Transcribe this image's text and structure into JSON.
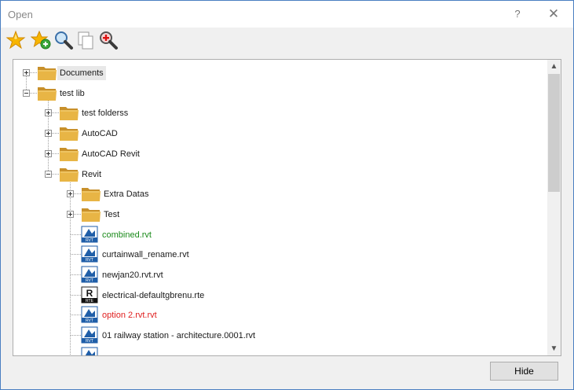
{
  "window": {
    "title": "Open",
    "help": "?",
    "close": "✕"
  },
  "toolbar": [
    {
      "icon": "star-icon",
      "name": "favorites-button"
    },
    {
      "icon": "add-favorite-icon",
      "name": "add-favorite-button"
    },
    {
      "icon": "search-icon",
      "name": "search-button"
    },
    {
      "icon": "copy-pages-icon",
      "name": "copy-button"
    },
    {
      "icon": "zoom-in-icon",
      "name": "zoom-button"
    }
  ],
  "tree": {
    "items": [
      {
        "label": "Documents",
        "kind": "folder",
        "level": 0,
        "expander": "plus",
        "selected": true
      },
      {
        "label": "test lib",
        "kind": "folder",
        "level": 0,
        "expander": "minus"
      },
      {
        "label": "test folderss",
        "kind": "folder",
        "level": 1,
        "expander": "plus"
      },
      {
        "label": "AutoCAD",
        "kind": "folder",
        "level": 1,
        "expander": "plus"
      },
      {
        "label": "AutoCAD Revit",
        "kind": "folder",
        "level": 1,
        "expander": "plus"
      },
      {
        "label": "Revit",
        "kind": "folder",
        "level": 1,
        "expander": "minus"
      },
      {
        "label": "Extra Datas",
        "kind": "folder",
        "level": 2,
        "expander": "plus"
      },
      {
        "label": "Test",
        "kind": "folder",
        "level": 2,
        "expander": "plus"
      },
      {
        "label": "combined.rvt",
        "kind": "rvt",
        "level": 2,
        "color": "#1a8a1a"
      },
      {
        "label": "curtainwall_rename.rvt",
        "kind": "rvt",
        "level": 2
      },
      {
        "label": "newjan20.rvt.rvt",
        "kind": "rvt",
        "level": 2
      },
      {
        "label": "electrical-defaultgbrenu.rte",
        "kind": "rte",
        "level": 2
      },
      {
        "label": "option 2.rvt.rvt",
        "kind": "rvt",
        "level": 2,
        "color": "#e02020"
      },
      {
        "label": "01 railway station - architecture.0001.rvt",
        "kind": "rvt",
        "level": 2
      },
      {
        "label": "",
        "kind": "rvt",
        "level": 2
      }
    ]
  },
  "file_badges": {
    "rvt": "RVT",
    "rte": "RTE",
    "rte_letter": "R"
  },
  "colors": {
    "folder": "#e8b545",
    "folder_dark": "#c8902a",
    "rvt_blue": "#1f5ea8",
    "accent_border": "#4a7fc1"
  },
  "scrollbar": {
    "up": "▲",
    "down": "▼"
  },
  "footer": {
    "hide_label": "Hide"
  }
}
